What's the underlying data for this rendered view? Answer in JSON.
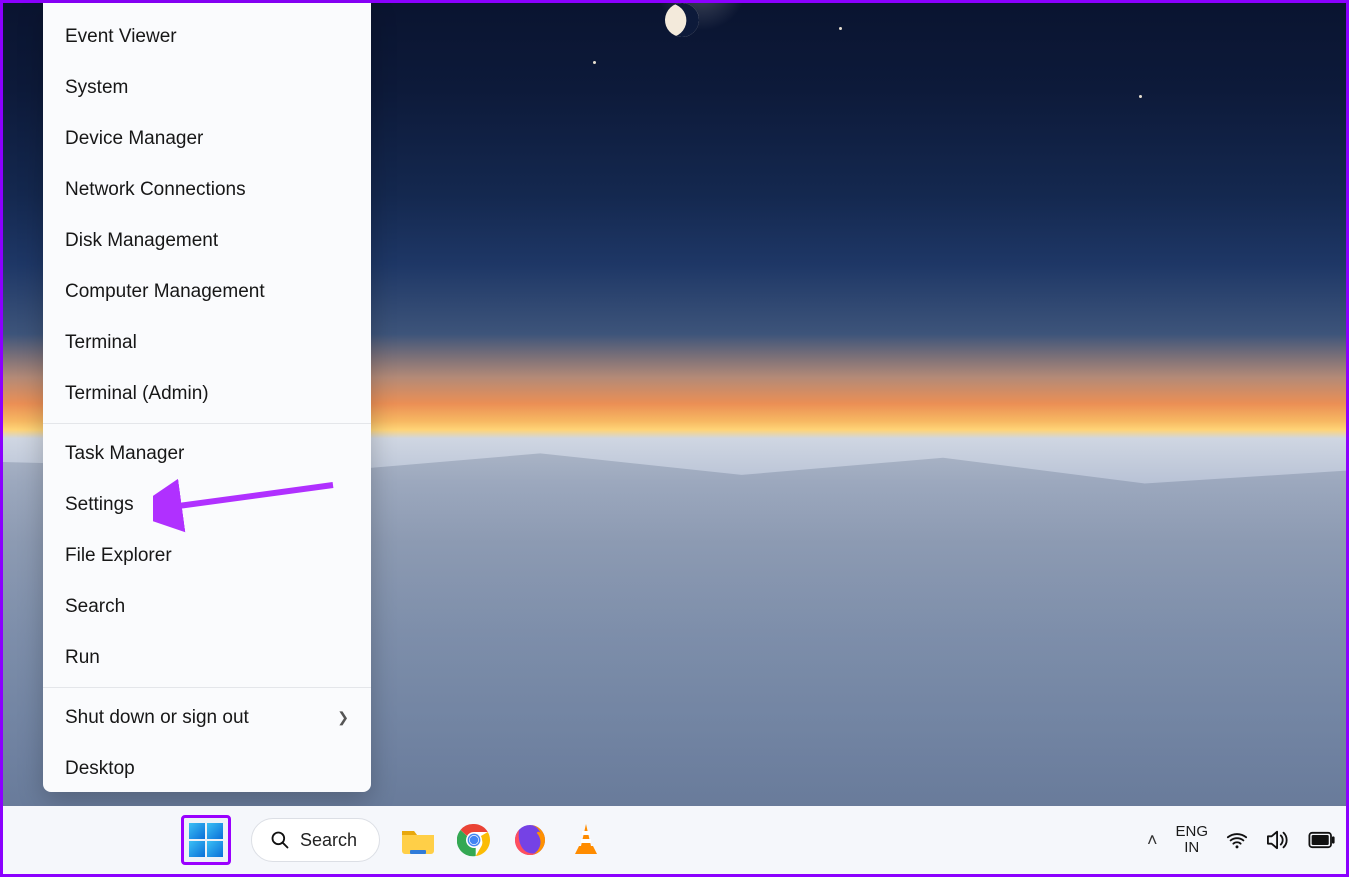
{
  "menu": {
    "items": [
      "Event Viewer",
      "System",
      "Device Manager",
      "Network Connections",
      "Disk Management",
      "Computer Management",
      "Terminal",
      "Terminal (Admin)"
    ],
    "items2": [
      "Task Manager",
      "Settings",
      "File Explorer",
      "Search",
      "Run"
    ],
    "items3": [
      {
        "label": "Shut down or sign out",
        "submenu": true
      },
      {
        "label": "Desktop",
        "submenu": false
      }
    ]
  },
  "taskbar": {
    "search_label": "Search"
  },
  "tray": {
    "lang_top": "ENG",
    "lang_bottom": "IN"
  },
  "annotation_target": "Settings"
}
